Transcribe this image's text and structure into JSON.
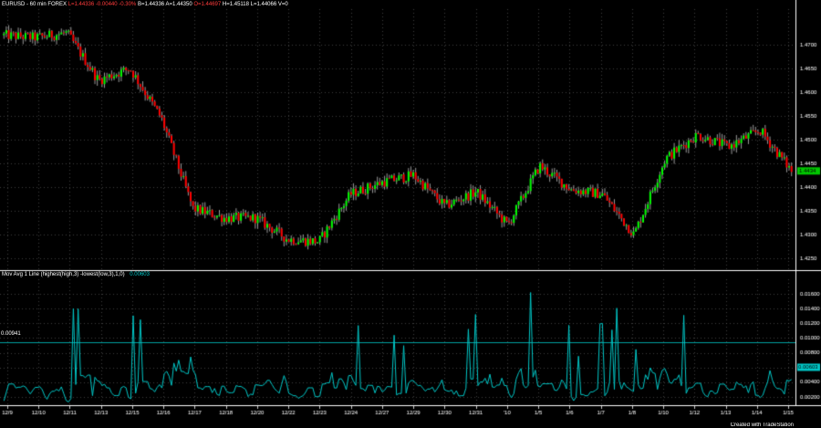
{
  "header": {
    "symbol": "EURUSD - 60 min FOREX",
    "last": "L=1.44336",
    "change": "-0.00440",
    "change_pct": "-0.30%",
    "bid": "B=1.44336",
    "ask": "A=1.44350",
    "open": "O=1.44697",
    "high": "H=1.45118",
    "low": "L=1.44066",
    "volume": "V=0"
  },
  "indicator": {
    "title": "Mov Avg 1 Line (highest(high,3) -lowest(low,3),1,0)",
    "value": "0.00603",
    "ref_line_label": "0.00941",
    "current_badge": "0.00603"
  },
  "price_badge": "1.4434",
  "footer": "Created with TradeStation",
  "colors": {
    "background": "#000000",
    "up_candle": "#00ff00",
    "down_candle": "#ff0000",
    "wick": "#ffffff",
    "indicator_line": "#00c8c8",
    "ref_line": "#00c8c8",
    "badge_bg": "#00c800",
    "grid": "#666666",
    "header_red": "#ff3b3b"
  },
  "chart_data": [
    {
      "type": "candlestick",
      "y_ticks": [
        "1.4700",
        "1.4650",
        "1.4600",
        "1.4550",
        "1.4500",
        "1.4450",
        "1.4400",
        "1.4350",
        "1.4300",
        "1.4250"
      ],
      "x_ticks": [
        "12/9",
        "12/10",
        "12/11",
        "12/13",
        "12/15",
        "12/16",
        "12/17",
        "12/18",
        "12/20",
        "12/22",
        "12/23",
        "12/24",
        "12/27",
        "12/29",
        "12/30",
        "12/31",
        "'10",
        "1/5",
        "1/6",
        "1/7",
        "1/8",
        "1/10",
        "1/12",
        "1/13",
        "1/14",
        "1/15"
      ],
      "ylim": [
        1.4225,
        1.4775
      ],
      "trend": {
        "x": [
          "12/9",
          "12/10",
          "12/11",
          "12/13",
          "12/15",
          "12/16",
          "12/17",
          "12/18",
          "12/20",
          "12/22",
          "12/23",
          "12/24",
          "12/27",
          "12/29",
          "12/30",
          "12/31",
          "'10",
          "1/5",
          "1/6",
          "1/7",
          "1/8",
          "1/10",
          "1/12",
          "1/13",
          "1/14",
          "1/15"
        ],
        "close": [
          1.472,
          1.4715,
          1.4725,
          1.4625,
          1.465,
          1.4545,
          1.4355,
          1.4335,
          1.4335,
          1.429,
          1.4285,
          1.4385,
          1.441,
          1.4425,
          1.436,
          1.439,
          1.432,
          1.4445,
          1.4395,
          1.4385,
          1.43,
          1.446,
          1.451,
          1.4485,
          1.452,
          1.4434
        ]
      }
    },
    {
      "type": "line",
      "title": "Mov Avg 1 Line (highest(high,3) -lowest(low,3),1,0)",
      "y_ticks": [
        "0.01600",
        "0.01400",
        "0.01200",
        "0.01000",
        "0.00800",
        "0.00600",
        "0.00400",
        "0.00200"
      ],
      "ylim": [
        0.001,
        0.018
      ],
      "ref_line": 0.00941,
      "last_value": 0.00603
    }
  ]
}
